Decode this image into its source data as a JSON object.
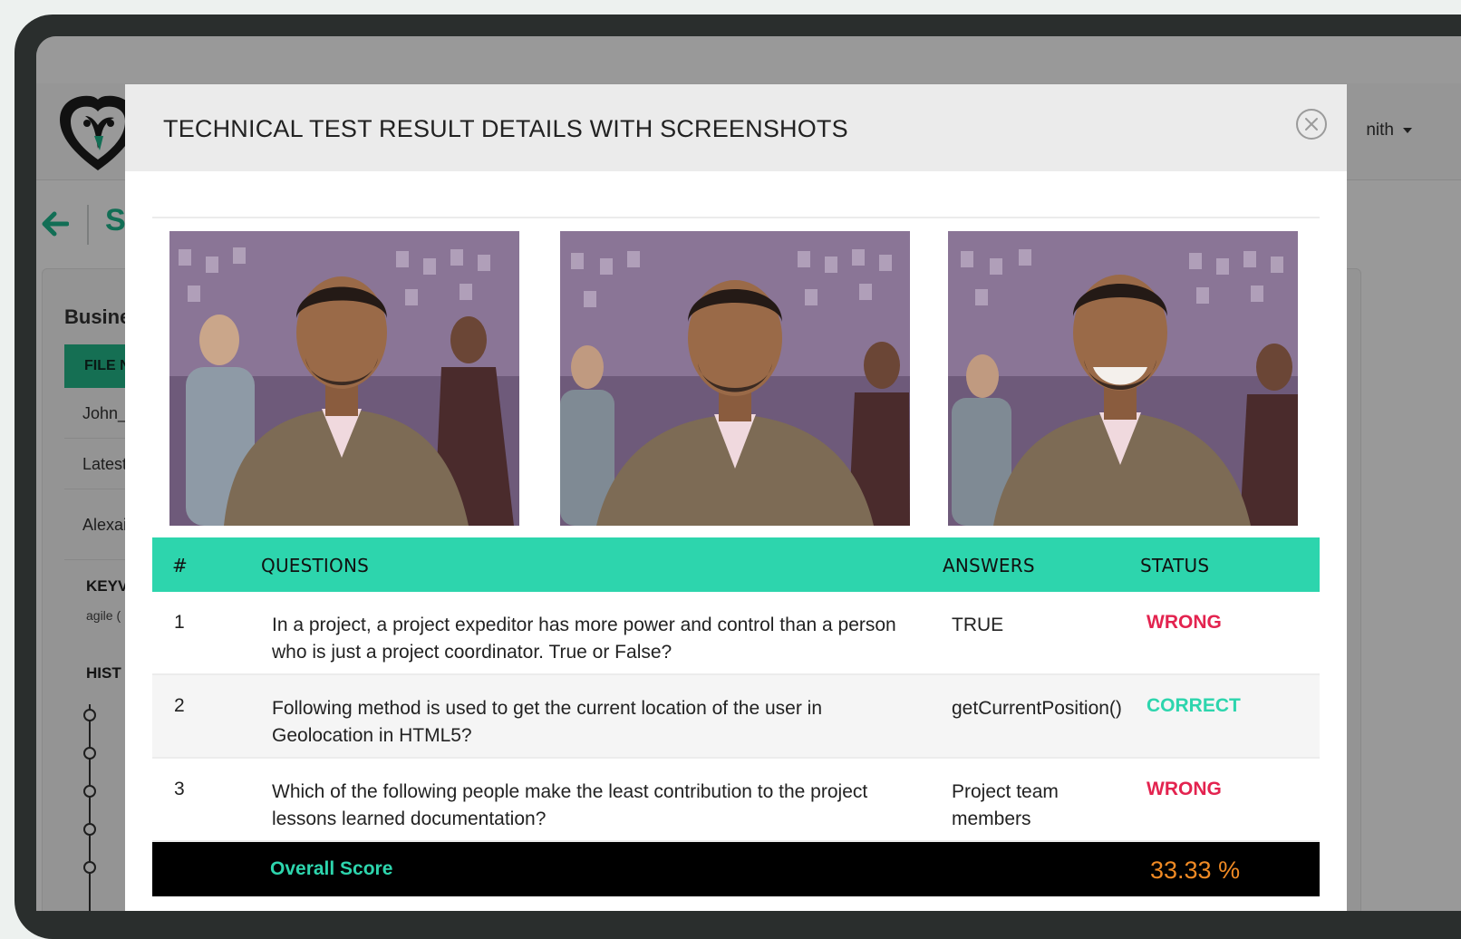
{
  "app": {
    "user_name": "nith",
    "back_title": "S",
    "panel_title": "Busine",
    "file_header": "FILE N",
    "rows": [
      "John_",
      "Latest",
      "Alexai"
    ],
    "keywords_title": "KEYV",
    "keywords_text": "agile (",
    "history_title": "HIST"
  },
  "modal": {
    "title": "TECHNICAL TEST RESULT DETAILS WITH SCREENSHOTS",
    "close_icon": "close-circle-icon"
  },
  "table": {
    "headers": {
      "num": "#",
      "questions": "QUESTIONS",
      "answers": "ANSWERS",
      "status": "STATUS"
    },
    "rows": [
      {
        "num": "1",
        "question": "In a project, a project expeditor has more power and control than a person who is just a project coordinator. True or False?",
        "answer": "TRUE",
        "status": "WRONG"
      },
      {
        "num": "2",
        "question": "Following method is used to get the current location of the user in Geolocation in HTML5?",
        "answer": "getCurrentPosition()",
        "status": "CORRECT"
      },
      {
        "num": "3",
        "question": "Which of the following people make the least contribution to the project lessons learned documentation?",
        "answer": "Project team members",
        "status": "WRONG"
      }
    ],
    "footer": {
      "label": "Overall Score",
      "score": "33.33 %"
    }
  },
  "colors": {
    "accent": "#2dd5ad",
    "wrong": "#e3234f",
    "score": "#f08a24",
    "brand_green": "#1fb88e"
  }
}
